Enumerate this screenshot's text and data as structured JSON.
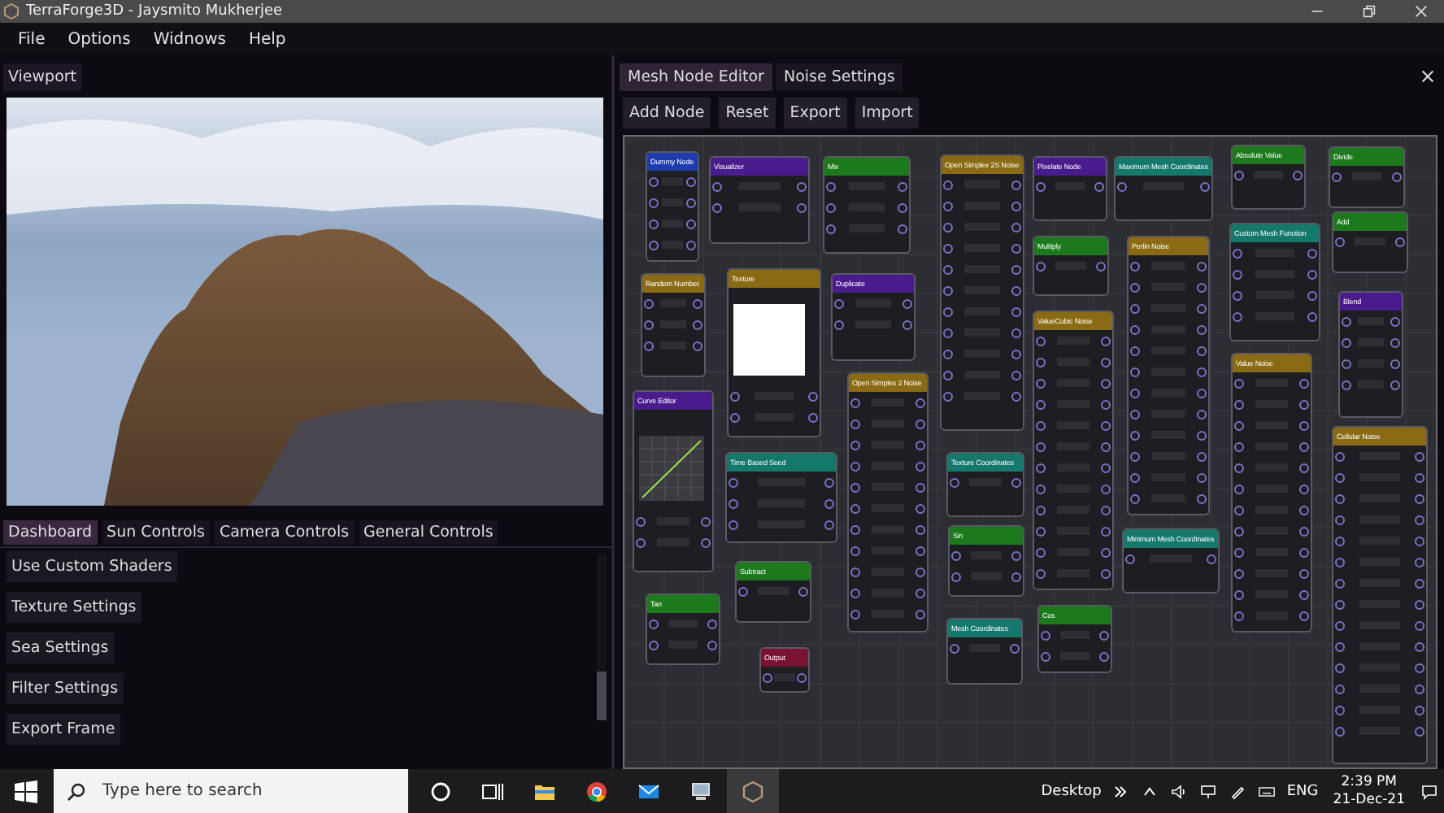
{
  "window": {
    "title": "TerraForge3D - Jaysmito Mukherjee"
  },
  "menu": [
    "File",
    "Options",
    "Widnows",
    "Help"
  ],
  "viewport": {
    "title": "Viewport"
  },
  "dashboard": {
    "tabs": [
      {
        "label": "Dashboard",
        "selected": true
      },
      {
        "label": "Sun Controls",
        "selected": false
      },
      {
        "label": "Camera Controls",
        "selected": false
      },
      {
        "label": "General Controls",
        "selected": false
      }
    ],
    "buttons": [
      "Use Custom Shaders",
      "Texture Settings",
      "Sea Settings",
      "Filter Settings",
      "Export Frame"
    ]
  },
  "node_editor": {
    "tabs": [
      {
        "label": "Mesh Node Editor",
        "selected": true
      },
      {
        "label": "Noise Settings",
        "selected": false
      }
    ],
    "toolbar": [
      "Add Node",
      "Reset",
      "Export",
      "Import"
    ],
    "nodes": [
      {
        "title": "Dummy Node",
        "color": "#1f3cae",
        "kind": "plain"
      },
      {
        "title": "Visualizer",
        "color": "#4a1b8c",
        "kind": "plain"
      },
      {
        "title": "Mix",
        "color": "#1c7a1c",
        "kind": "plain"
      },
      {
        "title": "Open Simplex 2S Noise",
        "color": "#8a6a12",
        "kind": "plain"
      },
      {
        "title": "Random Number",
        "color": "#8a6a12",
        "kind": "plain"
      },
      {
        "title": "Texture",
        "color": "#8a6a12",
        "kind": "texture"
      },
      {
        "title": "Duplicate",
        "color": "#4a1b8c",
        "kind": "plain"
      },
      {
        "title": "Curve Editor",
        "color": "#4a1b8c",
        "kind": "curve"
      },
      {
        "title": "Open Simplex 2 Noise",
        "color": "#8a6a12",
        "kind": "plain"
      },
      {
        "title": "Time Based Seed",
        "color": "#14786c",
        "kind": "plain"
      },
      {
        "title": "Subtract",
        "color": "#1c7a1c",
        "kind": "plain"
      },
      {
        "title": "Tan",
        "color": "#1c7a1c",
        "kind": "plain"
      },
      {
        "title": "Output",
        "color": "#7a1232",
        "kind": "plain"
      },
      {
        "title": "Texture Coordinates",
        "color": "#14786c",
        "kind": "plain"
      },
      {
        "title": "Sin",
        "color": "#1c7a1c",
        "kind": "plain"
      },
      {
        "title": "Mesh Coordinates",
        "color": "#14786c",
        "kind": "plain"
      },
      {
        "title": "Pixelate Node",
        "color": "#4a1b8c",
        "kind": "plain"
      },
      {
        "title": "Maximum Mesh Coordinates",
        "color": "#14786c",
        "kind": "plain"
      },
      {
        "title": "Absolute Value",
        "color": "#1c7a1c",
        "kind": "plain"
      },
      {
        "title": "Divide",
        "color": "#1c7a1c",
        "kind": "plain"
      },
      {
        "title": "Add",
        "color": "#1c7a1c",
        "kind": "plain"
      },
      {
        "title": "Custom Mesh Function",
        "color": "#14786c",
        "kind": "plain"
      },
      {
        "title": "Multiply",
        "color": "#1c7a1c",
        "kind": "plain"
      },
      {
        "title": "Perlin Noise",
        "color": "#8a6a12",
        "kind": "plain"
      },
      {
        "title": "Blend",
        "color": "#4a1b8c",
        "kind": "plain"
      },
      {
        "title": "ValueCubic Noise",
        "color": "#8a6a12",
        "kind": "plain"
      },
      {
        "title": "Value Noise",
        "color": "#8a6a12",
        "kind": "plain"
      },
      {
        "title": "Minimum Mesh Coordinates",
        "color": "#14786c",
        "kind": "plain"
      },
      {
        "title": "Cellular Noise",
        "color": "#8a6a12",
        "kind": "plain"
      },
      {
        "title": "Cos",
        "color": "#1c7a1c",
        "kind": "plain"
      }
    ]
  },
  "taskbar": {
    "search": {
      "placeholder": "Type here to search"
    },
    "desktop_label": "Desktop",
    "language": "ENG",
    "time": "2:39 PM",
    "date": "21-Dec-21"
  }
}
